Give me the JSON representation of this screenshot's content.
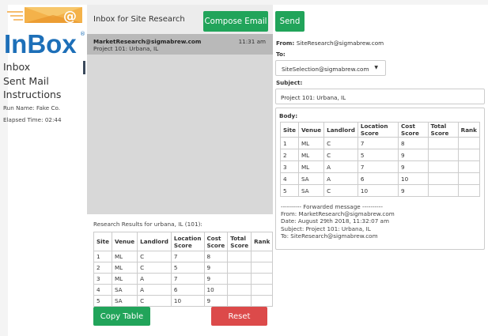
{
  "logo": {
    "text": "InBox",
    "reg": "®"
  },
  "sidebar": {
    "items": [
      {
        "label": "Inbox"
      },
      {
        "label": "Sent Mail"
      },
      {
        "label": "Instructions"
      }
    ],
    "run_name": "Run Name: Fake Co.",
    "elapsed": "Elapsed Time: 02:44"
  },
  "inbox": {
    "title": "Inbox for Site Research",
    "compose_label": "Compose Email",
    "messages": [
      {
        "from": "MarketResearch@sigmabrew.com",
        "subject": "Project 101: Urbana, IL",
        "time": "11:31 am"
      }
    ],
    "research_label": "Research Results for urbana, IL (101):",
    "table": {
      "headers": [
        "Site",
        "Venue",
        "Landlord",
        "Location Score",
        "Cost Score",
        "Total Score",
        "Rank"
      ],
      "rows": [
        [
          "1",
          "ML",
          "C",
          "7",
          "8",
          "",
          ""
        ],
        [
          "2",
          "ML",
          "C",
          "5",
          "9",
          "",
          ""
        ],
        [
          "3",
          "ML",
          "A",
          "7",
          "9",
          "",
          ""
        ],
        [
          "4",
          "SA",
          "A",
          "6",
          "10",
          "",
          ""
        ],
        [
          "5",
          "SA",
          "C",
          "10",
          "9",
          "",
          ""
        ]
      ]
    },
    "copy_label": "Copy Table",
    "reset_label": "Reset"
  },
  "compose": {
    "send_label": "Send",
    "from_label": "From:",
    "from_value": "SiteResearch@sigmabrew.com",
    "to_label": "To:",
    "to_value": "SiteSelection@sigmabrew.com",
    "subject_label": "Subject:",
    "subject_value": "Project 101:  Urbana, IL",
    "body_label": "Body:",
    "table": {
      "headers": [
        "Site",
        "Venue",
        "Landlord",
        "Location Score",
        "Cost Score",
        "Total Score",
        "Rank"
      ],
      "rows": [
        [
          "1",
          "ML",
          "C",
          "7",
          "8",
          "",
          ""
        ],
        [
          "2",
          "ML",
          "C",
          "5",
          "9",
          "",
          ""
        ],
        [
          "3",
          "ML",
          "A",
          "7",
          "9",
          "",
          ""
        ],
        [
          "4",
          "SA",
          "A",
          "6",
          "10",
          "",
          ""
        ],
        [
          "5",
          "SA",
          "C",
          "10",
          "9",
          "",
          ""
        ]
      ]
    },
    "forwarded": "---------- Forwarded message ----------\nFrom: MarketResearch@sigmabrew.com\nDate: August 29th 2018, 11:32:07 am\nSubject: Project 101: Urbana, IL\nTo: SiteResearch@sigmabrew.com"
  },
  "colors": {
    "green": "#21a45a",
    "red": "#dc4a4a",
    "brand_blue": "#1d6fb8",
    "envelope_orange": "#f3a53b"
  }
}
